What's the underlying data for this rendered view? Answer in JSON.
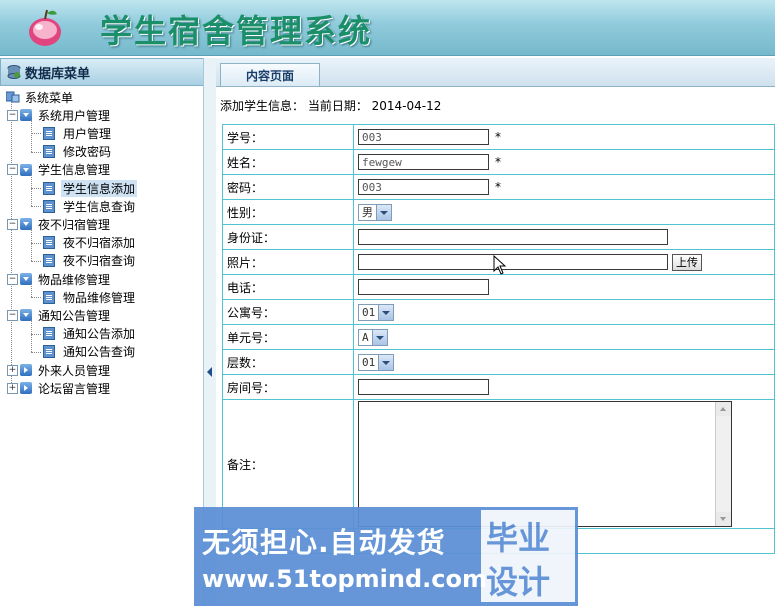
{
  "header": {
    "title": "学生宿舍管理系统"
  },
  "sidebar": {
    "title": "数据库菜单",
    "root": "系统菜单",
    "groups": [
      {
        "label": "系统用户管理",
        "items": [
          "用户管理",
          "修改密码"
        ]
      },
      {
        "label": "学生信息管理",
        "items": [
          "学生信息添加",
          "学生信息查询"
        ]
      },
      {
        "label": "夜不归宿管理",
        "items": [
          "夜不归宿添加",
          "夜不归宿查询"
        ]
      },
      {
        "label": "物品维修管理",
        "items": [
          "物品维修管理"
        ]
      },
      {
        "label": "通知公告管理",
        "items": [
          "通知公告添加",
          "通知公告查询"
        ]
      },
      {
        "label": "外来人员管理",
        "items": []
      },
      {
        "label": "论坛留言管理",
        "items": []
      }
    ],
    "selected": "学生信息添加"
  },
  "main": {
    "tab": "内容页面",
    "info": "添加学生信息：  当前日期：  2014-04-12",
    "form": {
      "student_no_label": "学号：",
      "student_no_value": "003",
      "name_label": "姓名：",
      "name_value": "fewgew",
      "password_label": "密码：",
      "password_value": "003",
      "required_mark": "*",
      "gender_label": "性别：",
      "gender_value": "男",
      "id_card_label": "身份证：",
      "id_card_value": "",
      "photo_label": "照片：",
      "photo_value": "",
      "upload_label": "上传",
      "phone_label": "电话：",
      "phone_value": "",
      "apartment_label": "公寓号：",
      "apartment_value": "01",
      "unit_label": "单元号：",
      "unit_value": "A",
      "floor_label": "层数：",
      "floor_value": "01",
      "room_label": "房间号：",
      "room_value": "",
      "remark_label": "备注：",
      "remark_value": ""
    }
  },
  "watermark": {
    "line1": "无须担心.自动发货",
    "line2": "www.51topmind.com",
    "side1": "毕业",
    "side2": "设计"
  },
  "colors": {
    "header_text": "#1b8f6a",
    "table_border": "#4fc3cf",
    "watermark_bg": "#5b8fd6"
  }
}
